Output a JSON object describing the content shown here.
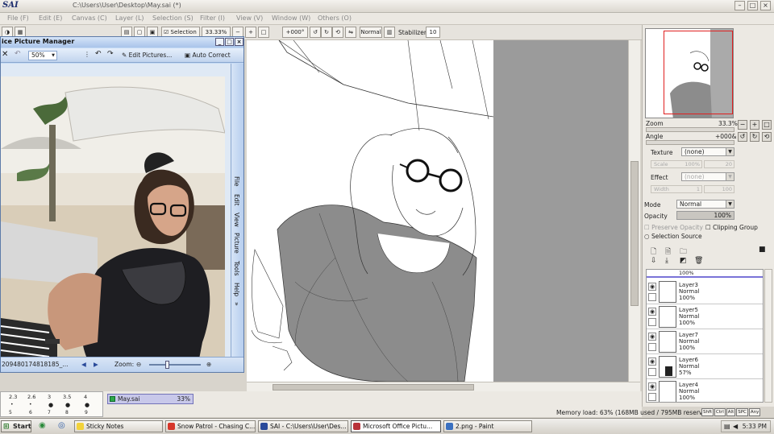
{
  "sai": {
    "logo": "SAI",
    "path": "C:\\Users\\User\\Desktop\\May.sai (*)",
    "menu": [
      "File (F)",
      "Edit (E)",
      "Canvas (C)",
      "Layer (L)",
      "Selection (S)",
      "Filter (I)",
      "View (V)",
      "Window (W)",
      "Others (O)"
    ],
    "toolbar": {
      "selection_label": "Selection",
      "zoom": "33.33%",
      "angle": "+000°",
      "blend_mode": "Normal",
      "stabilizer_label": "Stabilizer",
      "stabilizer_value": "10"
    }
  },
  "navigator": {
    "zoom_label": "Zoom",
    "zoom_value": "33.3%",
    "angle_label": "Angle",
    "angle_value": "+000&"
  },
  "brush_panel": {
    "texture_label": "Texture",
    "texture_value": "(none)",
    "scale_label": "Scale",
    "scale_value": "100%",
    "scale_num": "20",
    "effect_label": "Effect",
    "effect_value": "(none)",
    "width_label": "Width",
    "width_value": "1",
    "width_num": "100"
  },
  "layer_panel": {
    "mode_label": "Mode",
    "mode_value": "Normal",
    "opacity_label": "Opacity",
    "opacity_value": "100%",
    "preserve_opacity": "Preserve Opacity",
    "clipping_group": "Clipping Group",
    "selection_source": "Selection Source",
    "top_partial": "100%",
    "layers": [
      {
        "name": "Layer3",
        "mode": "Normal",
        "opacity": "100%"
      },
      {
        "name": "Layer5",
        "mode": "Normal",
        "opacity": "100%"
      },
      {
        "name": "Layer7",
        "mode": "Normal",
        "opacity": "100%"
      },
      {
        "name": "Layer6",
        "mode": "Normal",
        "opacity": "57%"
      },
      {
        "name": "Layer4",
        "mode": "Normal",
        "opacity": "100%"
      }
    ]
  },
  "swatches": {
    "row1": [
      "2.3",
      "2.6",
      "3",
      "3.5",
      "4"
    ],
    "row2": [
      "5",
      "6",
      "7",
      "8",
      "9"
    ]
  },
  "file_tab": {
    "name": "May.sai",
    "zoom": "33%"
  },
  "memory": "Memory load: 63% (168MB used / 795MB reserved)",
  "keys": [
    "Shft",
    "Ctrl",
    "Alt",
    "SPC",
    "Any"
  ],
  "picture_manager": {
    "title": "ice Picture Manager",
    "zoom": "50%",
    "edit_pictures": "Edit Pictures...",
    "auto_correct": "Auto Correct",
    "side_menu": [
      "File",
      "Edit",
      "View",
      "Picture",
      "Tools",
      "Help"
    ],
    "filename": "2094801748181​85_...",
    "zoom_label": "Zoom:"
  },
  "taskbar": {
    "start": "Start",
    "items": [
      {
        "label": "Sticky Notes",
        "color": "#f2d23a"
      },
      {
        "label": "Snow Patrol - Chasing C...",
        "color": "#d6372b"
      },
      {
        "label": "SAI - C:\\Users\\User\\Des...",
        "color": "#2a4a9a"
      },
      {
        "label": "Microsoft Office Pictu...",
        "color": "#b8323a"
      },
      {
        "label": "2.png - Paint",
        "color": "#3a70c0"
      }
    ],
    "clock": "5:33 PM"
  }
}
